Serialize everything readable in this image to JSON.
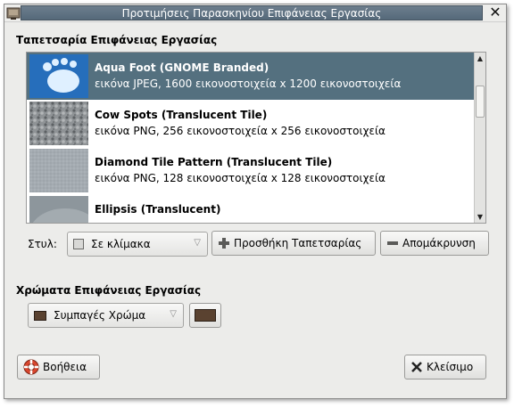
{
  "window": {
    "title": "Προτιμήσεις Παρασκηνίου Επιφάνειας Εργασίας"
  },
  "wallpaper_section": {
    "title": "Ταπετσαρία Επιφάνειας Εργασίας",
    "items": [
      {
        "title": "Aqua Foot (GNOME Branded)",
        "desc": "εικόνα JPEG, 1600 εικονοστοιχεία x 1200 εικονοστοιχεία",
        "thumb_icon": "gnome-foot-thumbnail",
        "selected": true
      },
      {
        "title": "Cow Spots (Translucent Tile)",
        "desc": "εικόνα PNG, 256 εικονοστοιχεία x 256 εικονοστοιχεία",
        "thumb_icon": "cow-spots-thumbnail",
        "selected": false
      },
      {
        "title": "Diamond Tile Pattern (Translucent Tile)",
        "desc": "εικόνα PNG, 128 εικονοστοιχεία x 128 εικονοστοιχεία",
        "thumb_icon": "diamond-tile-thumbnail",
        "selected": false
      },
      {
        "title": "Ellipsis (Translucent)",
        "desc": "",
        "thumb_icon": "ellipsis-thumbnail",
        "selected": false
      }
    ],
    "style_label": "Στυλ:",
    "style_value": "Σε κλίμακα",
    "add_button": "Προσθήκη Ταπετσαρίας",
    "remove_button": "Απομάκρυνση"
  },
  "colors_section": {
    "title": "Χρώματα Επιφάνειας Εργασίας",
    "color_mode": "Συμπαγές Χρώμα",
    "color_hex": "#5a4230"
  },
  "footer": {
    "help_button": "Βοήθεια",
    "close_button": "Κλείσιμο"
  },
  "colors": {
    "selection": "#54707f",
    "title_bar": "#5d7181"
  }
}
